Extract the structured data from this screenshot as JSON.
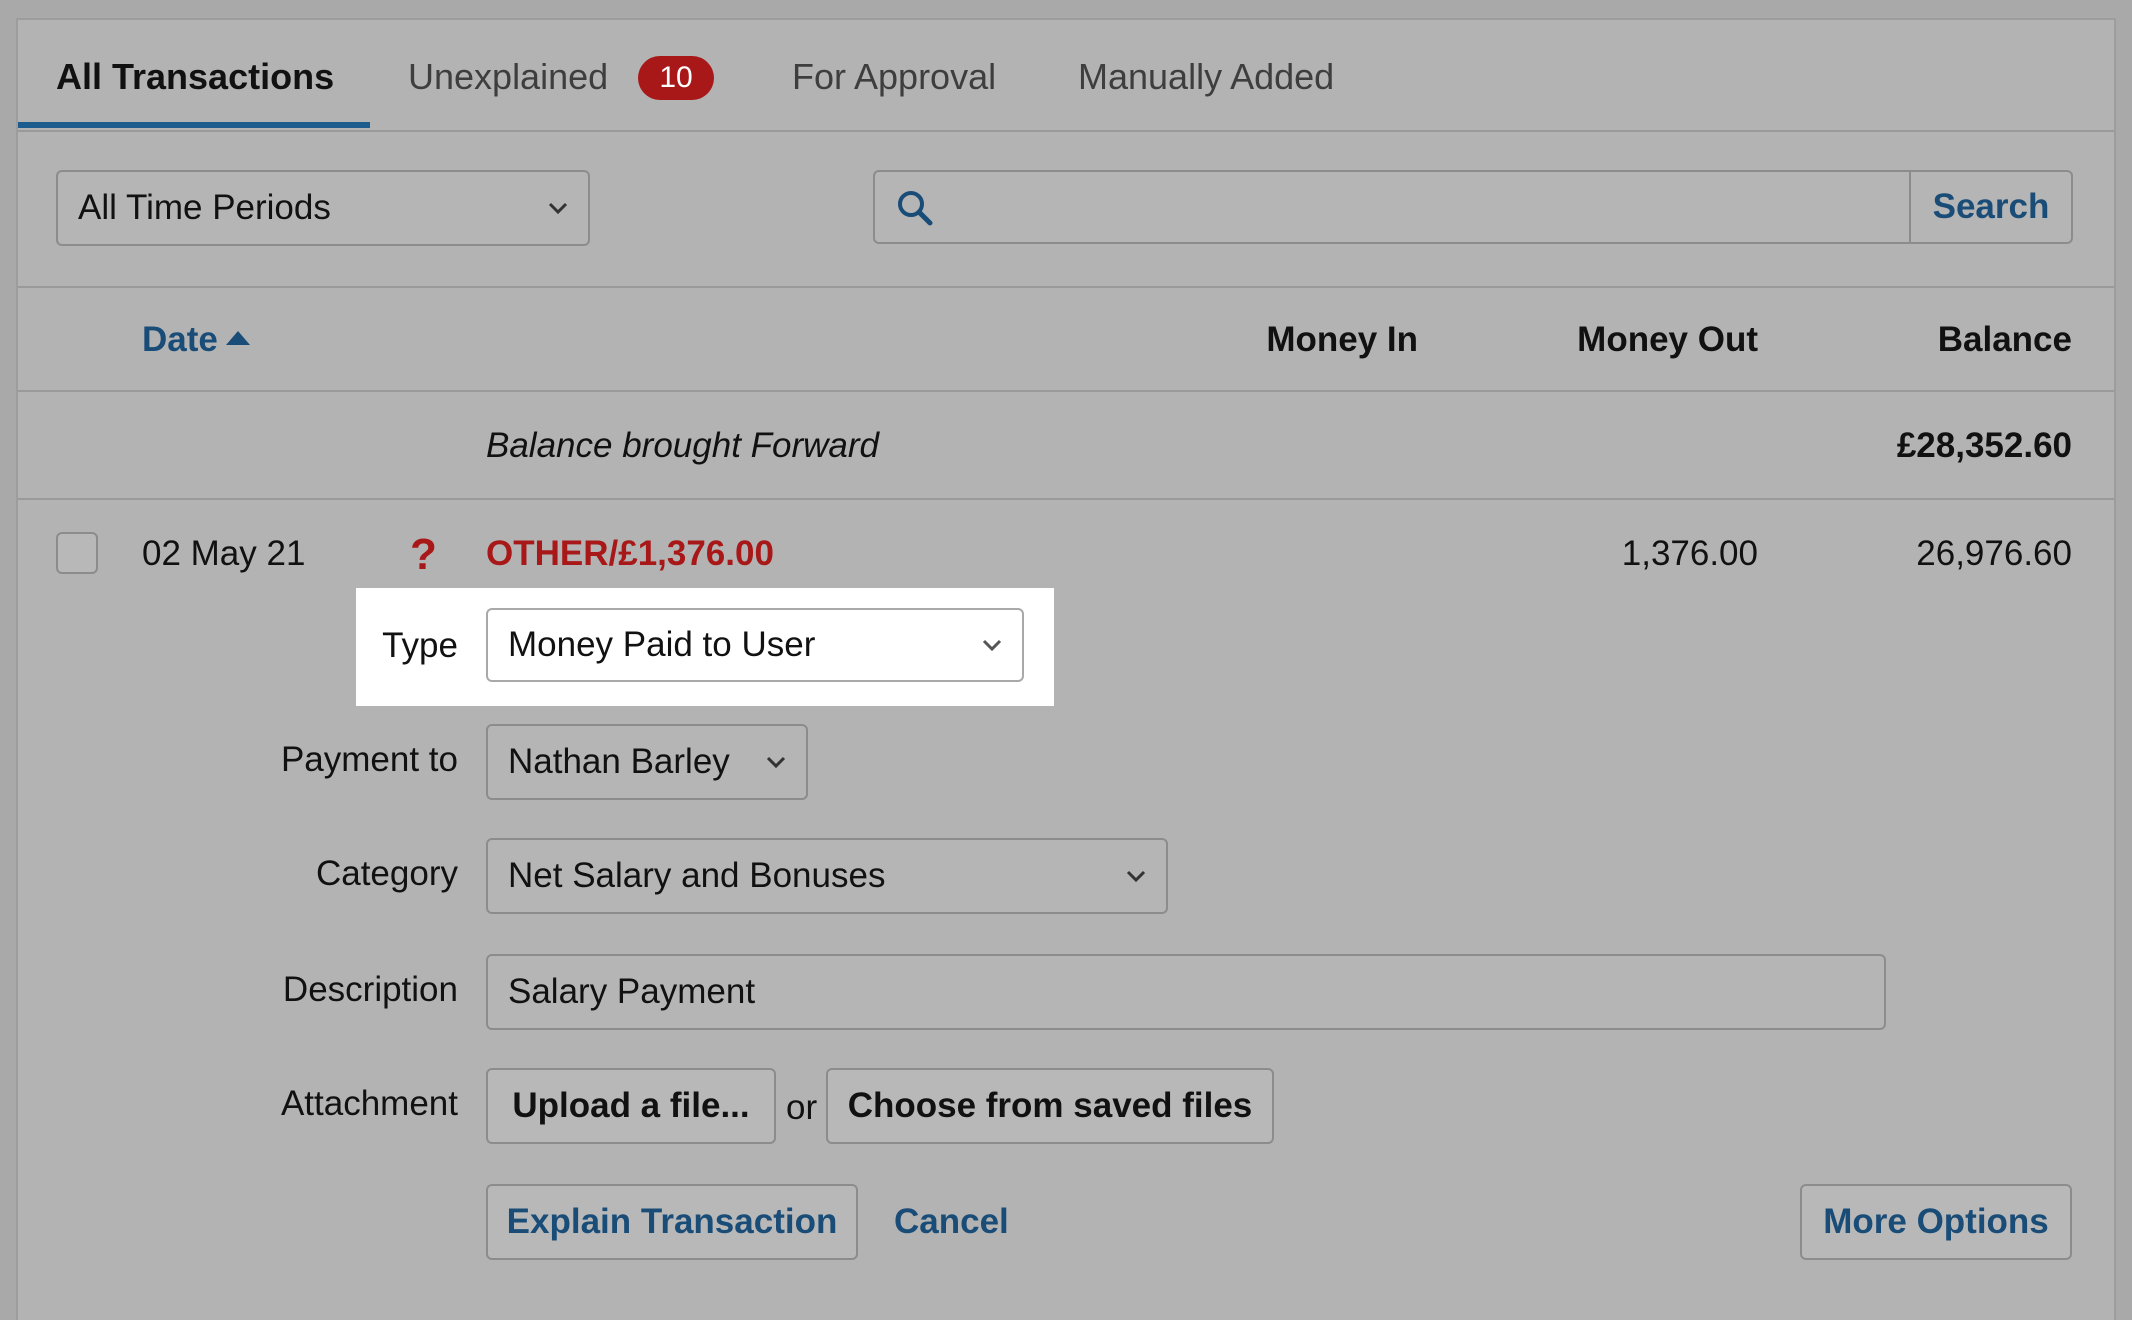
{
  "tabs": [
    {
      "label": "All Transactions",
      "active": true
    },
    {
      "label": "Unexplained",
      "badge": "10"
    },
    {
      "label": "For Approval"
    },
    {
      "label": "Manually Added"
    }
  ],
  "filters": {
    "period_value": "All Time Periods",
    "search_button": "Search",
    "search_value": ""
  },
  "table": {
    "headers": {
      "date": "Date",
      "money_in": "Money In",
      "money_out": "Money Out",
      "balance": "Balance"
    },
    "brought_forward": {
      "label": "Balance brought Forward",
      "balance": "£28,352.60"
    },
    "transaction": {
      "date": "02 May 21",
      "status_icon": "question-mark-icon",
      "description": "OTHER/£1,376.00",
      "money_out": "1,376.00",
      "balance": "26,976.60"
    }
  },
  "form": {
    "type_label": "Type",
    "type_value": "Money Paid to User",
    "payment_to_label": "Payment to",
    "payment_to_value": "Nathan Barley",
    "category_label": "Category",
    "category_value": "Net Salary and Bonuses",
    "description_label": "Description",
    "description_value": "Salary Payment",
    "attachment_label": "Attachment",
    "upload_button": "Upload a file...",
    "or_text": "or",
    "choose_button": "Choose from saved files",
    "explain_button": "Explain Transaction",
    "cancel_link": "Cancel",
    "more_options_button": "More Options"
  },
  "colors": {
    "accent_blue": "#1a4c78",
    "alert_red": "#a81818",
    "highlight": "#ffffff"
  }
}
